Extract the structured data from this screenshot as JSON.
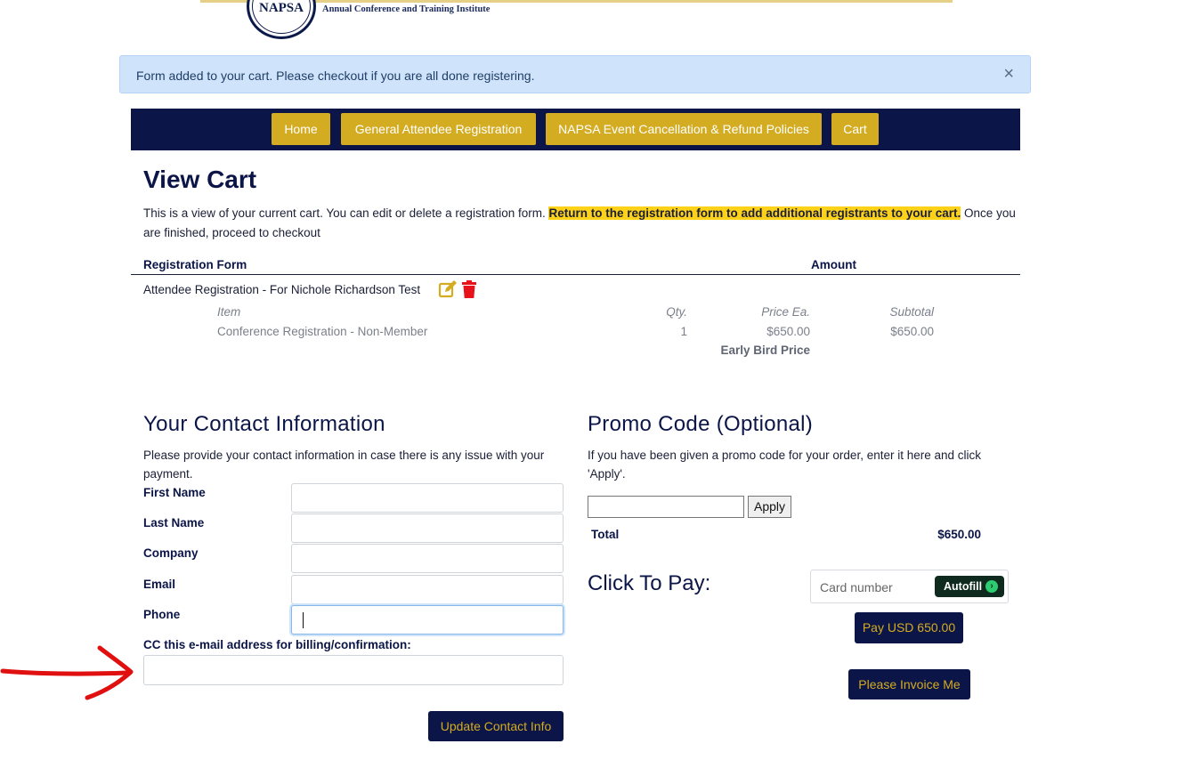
{
  "header": {
    "logo_text": "NAPSA",
    "subtitle": "Annual Conference and Training Institute"
  },
  "alert": {
    "message": "Form added to your cart. Please checkout if you are all done registering.",
    "close_glyph": "×"
  },
  "nav": {
    "items": [
      {
        "label": "Home"
      },
      {
        "label": "General Attendee Registration"
      },
      {
        "label": "NAPSA Event Cancellation & Refund Policies"
      },
      {
        "label": "Cart"
      }
    ]
  },
  "cart": {
    "title": "View Cart",
    "intro_plain": "This is a view of your current cart. You can edit or delete a registration form.",
    "intro_highlight": "Return to the registration form to add additional registrants to your cart.",
    "intro_tail": "Once you are finished, proceed to checkout",
    "col_form": "Registration Form",
    "col_amount": "Amount",
    "registration": "Attendee Registration - For Nichole Richardson Test",
    "item_headers": {
      "item": "Item",
      "qty": "Qty.",
      "price": "Price Ea.",
      "subtotal": "Subtotal"
    },
    "item": {
      "name": "Conference Registration - Non-Member",
      "qty": "1",
      "price": "$650.00",
      "subtotal": "$650.00"
    },
    "price_note": "Early Bird Price"
  },
  "contact": {
    "title": "Your Contact Information",
    "description": "Please provide your contact information in case there is any issue with your payment.",
    "fields": [
      {
        "label": "First Name",
        "value": ""
      },
      {
        "label": "Last Name",
        "value": ""
      },
      {
        "label": "Company",
        "value": ""
      },
      {
        "label": "Email",
        "value": ""
      },
      {
        "label": "Phone",
        "value": ""
      }
    ],
    "cc_label": "CC this e-mail address for billing/confirmation:",
    "cc_value": "",
    "update_button": "Update Contact Info"
  },
  "promo": {
    "title": "Promo Code (Optional)",
    "description": "If you have been given a promo code for your order, enter it here and click 'Apply'.",
    "input_value": "",
    "apply_label": "Apply",
    "total_label": "Total",
    "total_value": "$650.00"
  },
  "payment": {
    "title": "Click To Pay:",
    "card_placeholder": "Card number",
    "autofill_label": "Autofill",
    "pay_button": "Pay USD 650.00",
    "invoice_button": "Please Invoice Me"
  },
  "colors": {
    "navy": "#0b1547",
    "gold": "#d4ac22",
    "highlight": "#ffd21a",
    "alert_bg": "#cfe4fb",
    "delete_red": "#e8121b",
    "annotation_arrow": "#e01010"
  },
  "icons": {
    "edit": "edit-icon",
    "delete": "trash-icon",
    "close": "close-icon",
    "autofill": "chevron-right-icon"
  }
}
